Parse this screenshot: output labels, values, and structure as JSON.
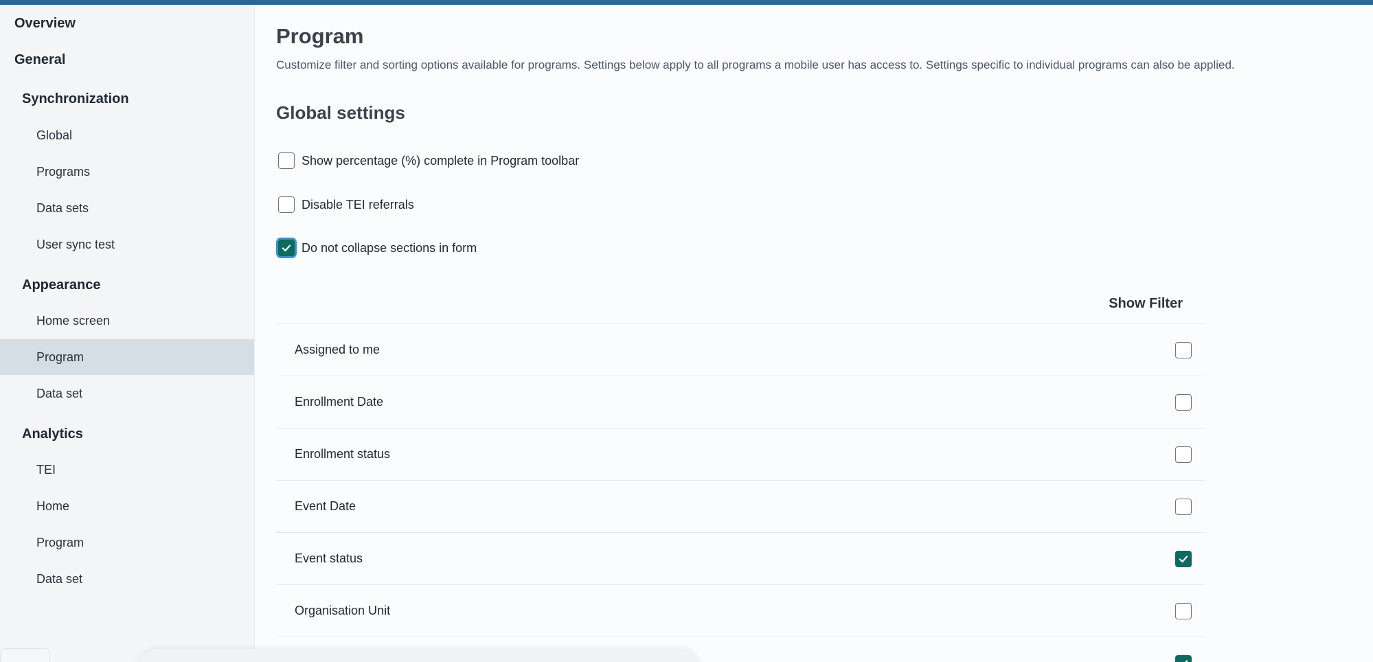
{
  "sidebar": {
    "items": [
      {
        "label": "Overview",
        "level": 1
      },
      {
        "label": "General",
        "level": 1
      },
      {
        "label": "Synchronization",
        "level": 2
      },
      {
        "label": "Global",
        "level": 3
      },
      {
        "label": "Programs",
        "level": 3
      },
      {
        "label": "Data sets",
        "level": 3
      },
      {
        "label": "User sync test",
        "level": 3
      },
      {
        "label": "Appearance",
        "level": 2
      },
      {
        "label": "Home screen",
        "level": 3
      },
      {
        "label": "Program",
        "level": 3,
        "active": true
      },
      {
        "label": "Data set",
        "level": 3
      },
      {
        "label": "Analytics",
        "level": 2
      },
      {
        "label": "TEI",
        "level": 3
      },
      {
        "label": "Home",
        "level": 3
      },
      {
        "label": "Program",
        "level": 3
      },
      {
        "label": "Data set",
        "level": 3
      }
    ]
  },
  "main": {
    "title": "Program",
    "description": "Customize filter and sorting options available for programs. Settings below apply to all programs a mobile user has access to. Settings specific to individual programs can also be applied.",
    "global_settings": {
      "title": "Global settings",
      "options": [
        {
          "label": "Show percentage (%) complete in Program toolbar",
          "checked": false
        },
        {
          "label": "Disable TEI referrals",
          "checked": false
        },
        {
          "label": "Do not collapse sections in form",
          "checked": true
        }
      ]
    },
    "filters": {
      "column_header": "Show Filter",
      "rows": [
        {
          "label": "Assigned to me",
          "checked": false
        },
        {
          "label": "Enrollment Date",
          "checked": false
        },
        {
          "label": "Enrollment status",
          "checked": false
        },
        {
          "label": "Event Date",
          "checked": false
        },
        {
          "label": "Event status",
          "checked": true
        },
        {
          "label": "Organisation Unit",
          "checked": false
        }
      ]
    }
  },
  "colors": {
    "topbar": "#2d6693",
    "checkbox_checked": "#0c6a5e",
    "sidebar_active": "#d5dde5",
    "focus_ring": "#3c8fd2"
  }
}
